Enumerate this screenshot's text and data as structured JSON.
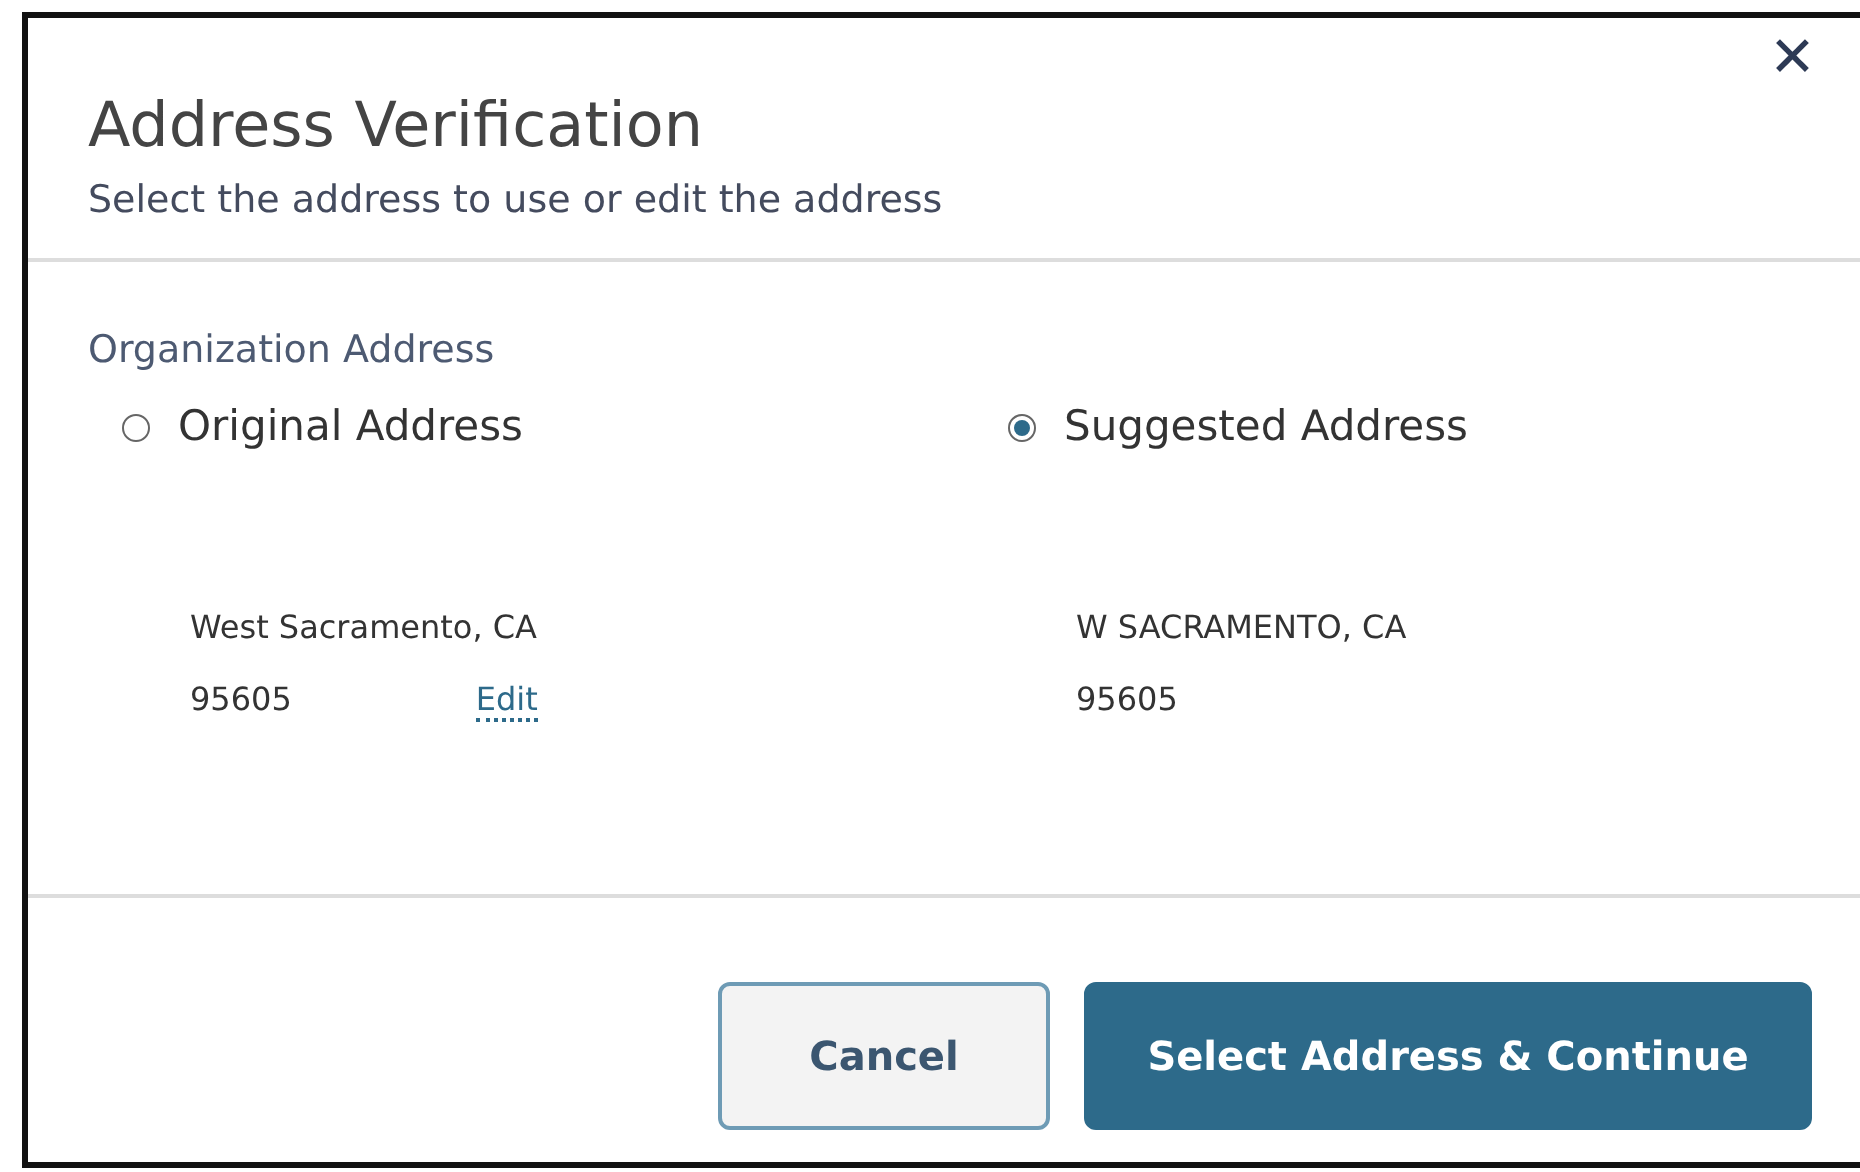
{
  "dialog": {
    "title": "Address Verification",
    "subtitle": "Select the address to use or edit the address",
    "close": "✕"
  },
  "section_label": "Organization Address",
  "options": [
    {
      "label": "Original Address",
      "selected": false,
      "lines": [
        "West Sacramento, CA",
        "95605"
      ],
      "edit_link": "Edit"
    },
    {
      "label": "Suggested Address",
      "selected": true,
      "lines": [
        "W SACRAMENTO, CA",
        "95605"
      ]
    }
  ],
  "buttons": [
    {
      "label": "Cancel",
      "kind": "secondary"
    },
    {
      "label": "Select Address & Continue",
      "kind": "primary"
    }
  ]
}
